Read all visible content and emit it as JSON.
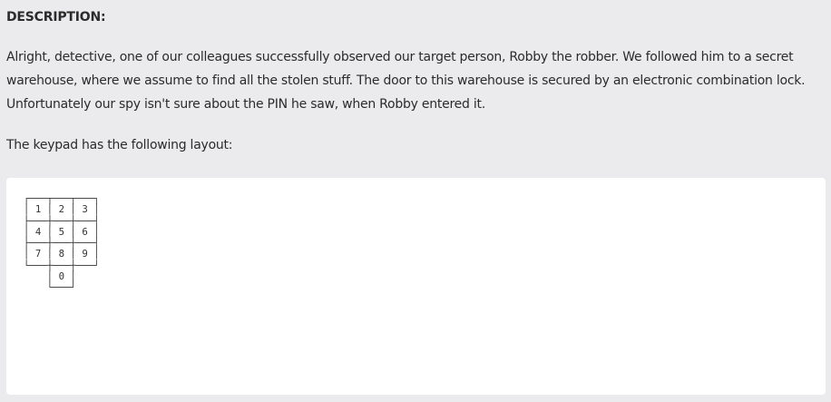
{
  "description": {
    "heading": "DESCRIPTION:",
    "paragraph": "Alright, detective, one of our colleagues successfully observed our target person, Robby the robber. We followed him to a secret warehouse, where we assume to find all the stolen stuff. The door to this warehouse is secured by an electronic combination lock. Unfortunately our spy isn't sure about the PIN he saw, when Robby entered it.",
    "keypad_intro": "The keypad has the following layout:"
  },
  "code_block": {
    "keypad_layout": "┌───┬───┬───┐\n│ 1 │ 2 │ 3 │\n├───┼───┼───┤\n│ 4 │ 5 │ 6 │\n├───┼───┼───┤\n│ 7 │ 8 │ 9 │\n└───┼───┼───┘\n    │ 0 │\n    └───┘"
  }
}
